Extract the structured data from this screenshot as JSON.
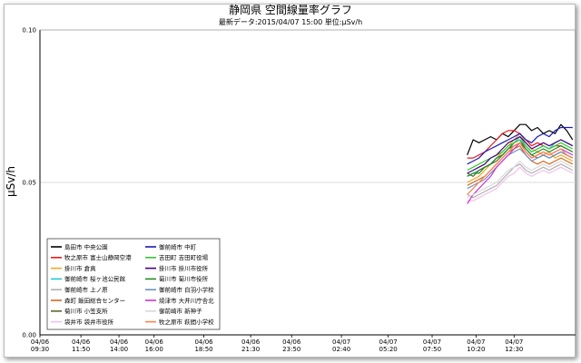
{
  "chart_data": {
    "type": "line",
    "title": "静岡県 空間線量率グラフ",
    "subtitle": "最新データ:2015/04/07 15:00 単位:μSv/h",
    "ylabel": "μSv/h",
    "xlabel": "",
    "ylim": [
      0,
      0.1
    ],
    "yticks": [
      {
        "value": 0,
        "label": "0.00"
      },
      {
        "value": 0.05,
        "label": "0.05"
      },
      {
        "value": 0.1,
        "label": "0.10"
      }
    ],
    "x_range_hours": [
      0,
      30.5
    ],
    "xticks": [
      {
        "h": 0,
        "date": "04/06",
        "time": "09:30"
      },
      {
        "h": 2.333,
        "date": "04/06",
        "time": "11:50"
      },
      {
        "h": 4.5,
        "date": "04/06",
        "time": "14:00"
      },
      {
        "h": 6.5,
        "date": "04/06",
        "time": "16:00"
      },
      {
        "h": 9.333,
        "date": "04/06",
        "time": "18:50"
      },
      {
        "h": 12,
        "date": "04/06",
        "time": "21:30"
      },
      {
        "h": 14.333,
        "date": "04/06",
        "time": "23:50"
      },
      {
        "h": 17.167,
        "date": "04/07",
        "time": "02:40"
      },
      {
        "h": 19.833,
        "date": "04/07",
        "time": "05:20"
      },
      {
        "h": 22.333,
        "date": "04/07",
        "time": "07:50"
      },
      {
        "h": 24.833,
        "date": "04/07",
        "time": "10:20"
      },
      {
        "h": 27,
        "date": "04/07",
        "time": "12:30"
      }
    ],
    "series_x_hours": [
      24.333,
      24.667,
      25,
      25.333,
      25.667,
      26,
      26.333,
      26.667,
      27,
      27.333,
      27.667,
      28,
      28.333,
      28.667,
      29,
      29.333,
      29.667,
      30,
      30.333
    ],
    "series": [
      {
        "name": "島田市 中央公園",
        "color": "#000000",
        "values": [
          0.059,
          0.064,
          0.063,
          0.064,
          0.065,
          0.064,
          0.066,
          0.065,
          0.067,
          0.069,
          0.069,
          0.067,
          0.068,
          0.066,
          0.067,
          0.066,
          0.069,
          0.067,
          0.064
        ]
      },
      {
        "name": "牧之原市 富士山静岡空港",
        "color": "#ee1c1c",
        "values": [
          0.058,
          0.058,
          0.059,
          0.06,
          0.062,
          0.064,
          0.066,
          0.067,
          0.067,
          0.066,
          0.064,
          0.062,
          0.063,
          0.062,
          0.061,
          0.062,
          0.062,
          0.061,
          0.06
        ]
      },
      {
        "name": "掛川市 倉真",
        "color": "#f5a623",
        "values": [
          0.05,
          0.051,
          0.052,
          0.054,
          0.056,
          0.058,
          0.06,
          0.062,
          0.064,
          0.066,
          0.063,
          0.061,
          0.06,
          0.059,
          0.06,
          0.058,
          0.059,
          0.058,
          0.057
        ]
      },
      {
        "name": "御前崎市 桜ヶ池公民館",
        "color": "#20c8d8",
        "values": [
          0.052,
          0.053,
          0.054,
          0.055,
          0.056,
          0.058,
          0.059,
          0.061,
          0.063,
          0.065,
          0.062,
          0.06,
          0.061,
          0.062,
          0.061,
          0.063,
          0.064,
          0.063,
          0.062
        ]
      },
      {
        "name": "御前崎市 上ノ原",
        "color": "#b0b0b0",
        "values": [
          0.046,
          0.045,
          0.046,
          0.047,
          0.048,
          0.049,
          0.051,
          0.053,
          0.055,
          0.056,
          0.054,
          0.053,
          0.054,
          0.055,
          0.054,
          0.055,
          0.056,
          0.055,
          0.054
        ]
      },
      {
        "name": "森町 飯田総合センター",
        "color": "#d2691e",
        "values": [
          0.049,
          0.05,
          0.051,
          0.052,
          0.054,
          0.056,
          0.058,
          0.06,
          0.061,
          0.062,
          0.059,
          0.057,
          0.056,
          0.057,
          0.056,
          0.057,
          0.058,
          0.057,
          0.056
        ]
      },
      {
        "name": "菊川市 小笠支所",
        "color": "#556b2f",
        "values": [
          0.053,
          0.052,
          0.054,
          0.055,
          0.056,
          0.057,
          0.059,
          0.061,
          0.063,
          0.064,
          0.061,
          0.059,
          0.058,
          0.059,
          0.058,
          0.059,
          0.06,
          0.059,
          0.058
        ]
      },
      {
        "name": "袋井市 袋井市役所",
        "color": "#f0c0e8",
        "values": [
          0.044,
          0.044,
          0.045,
          0.046,
          0.047,
          0.048,
          0.05,
          0.052,
          0.053,
          0.055,
          0.053,
          0.052,
          0.053,
          0.054,
          0.053,
          0.054,
          0.055,
          0.054,
          0.053
        ]
      },
      {
        "name": "御前崎市 中町",
        "color": "#1a1ab8",
        "values": [
          0.056,
          0.057,
          0.058,
          0.06,
          0.061,
          0.062,
          0.063,
          0.064,
          0.065,
          0.066,
          0.064,
          0.063,
          0.065,
          0.066,
          0.065,
          0.067,
          0.068,
          0.068,
          0.068
        ]
      },
      {
        "name": "吉田町 吉田町役場",
        "color": "#33cc33",
        "values": [
          0.054,
          0.055,
          0.056,
          0.057,
          0.058,
          0.059,
          0.06,
          0.062,
          0.063,
          0.064,
          0.062,
          0.06,
          0.061,
          0.062,
          0.061,
          0.062,
          0.063,
          0.062,
          0.061
        ]
      },
      {
        "name": "掛川市 掛川市役所",
        "color": "#4b0082",
        "values": [
          0.053,
          0.054,
          0.055,
          0.056,
          0.058,
          0.059,
          0.061,
          0.063,
          0.064,
          0.065,
          0.063,
          0.061,
          0.062,
          0.063,
          0.062,
          0.063,
          0.064,
          0.063,
          0.062
        ]
      },
      {
        "name": "菊川市 菊川市役所",
        "color": "#228b22",
        "values": [
          0.052,
          0.053,
          0.053,
          0.055,
          0.056,
          0.058,
          0.059,
          0.061,
          0.062,
          0.063,
          0.061,
          0.059,
          0.06,
          0.061,
          0.06,
          0.061,
          0.062,
          0.061,
          0.06
        ]
      },
      {
        "name": "御前崎市 白羽小学校",
        "color": "#7090c0",
        "values": [
          0.048,
          0.049,
          0.05,
          0.051,
          0.053,
          0.055,
          0.057,
          0.059,
          0.06,
          0.061,
          0.059,
          0.057,
          0.058,
          0.059,
          0.058,
          0.059,
          0.06,
          0.059,
          0.058
        ]
      },
      {
        "name": "焼津市 大井川庁舎北",
        "color": "#cc33cc",
        "values": [
          0.043,
          0.046,
          0.048,
          0.05,
          0.052,
          0.055,
          0.057,
          0.059,
          0.061,
          0.063,
          0.06,
          0.058,
          0.059,
          0.06,
          0.059,
          0.06,
          0.061,
          0.06,
          0.059
        ]
      },
      {
        "name": "御前崎市 新神子",
        "color": "#d8d8d8",
        "values": [
          0.045,
          0.046,
          0.047,
          0.048,
          0.049,
          0.05,
          0.052,
          0.054,
          0.055,
          0.057,
          0.055,
          0.054,
          0.055,
          0.056,
          0.055,
          0.056,
          0.057,
          0.056,
          0.055
        ]
      },
      {
        "name": "牧之原市 萩間小学校",
        "color": "#ff7f50",
        "values": [
          0.046,
          0.048,
          0.05,
          0.052,
          0.054,
          0.056,
          0.058,
          0.06,
          0.062,
          0.063,
          0.06,
          0.058,
          0.059,
          0.06,
          0.059,
          0.06,
          0.061,
          0.059,
          0.058
        ]
      }
    ]
  }
}
